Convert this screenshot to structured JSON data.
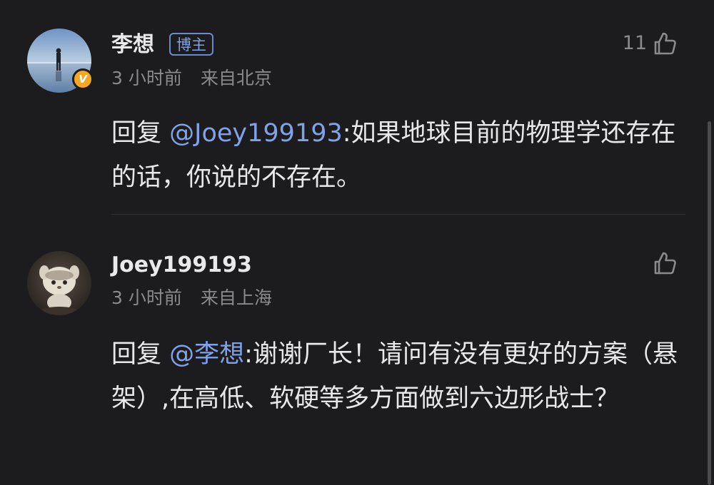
{
  "comments": [
    {
      "username": "李想",
      "author_badge": "博主",
      "verified_mark": "V",
      "time": "3 小时前",
      "location": "来自北京",
      "like_count": "11",
      "reply_prefix": "回复 ",
      "mention": "@Joey199193",
      "text": ":如果地球目前的物理学还存在的话，你说的不存在。",
      "avatar_icon": "avatar-photo-person-on-salt-flat"
    },
    {
      "username": "Joey199193",
      "time": "3 小时前",
      "location": "来自上海",
      "like_count": "",
      "reply_prefix": "回复 ",
      "mention": "@李想",
      "text": ":谢谢厂长！请问有没有更好的方案（悬架）,在高低、软硬等多方面做到六边形战士？",
      "avatar_icon": "avatar-photo-plush-toy"
    }
  ],
  "colors": {
    "background": "#1c1c1e",
    "mention": "#7fa2e8",
    "verified": "#f5a623",
    "meta": "#8a8a8e"
  }
}
